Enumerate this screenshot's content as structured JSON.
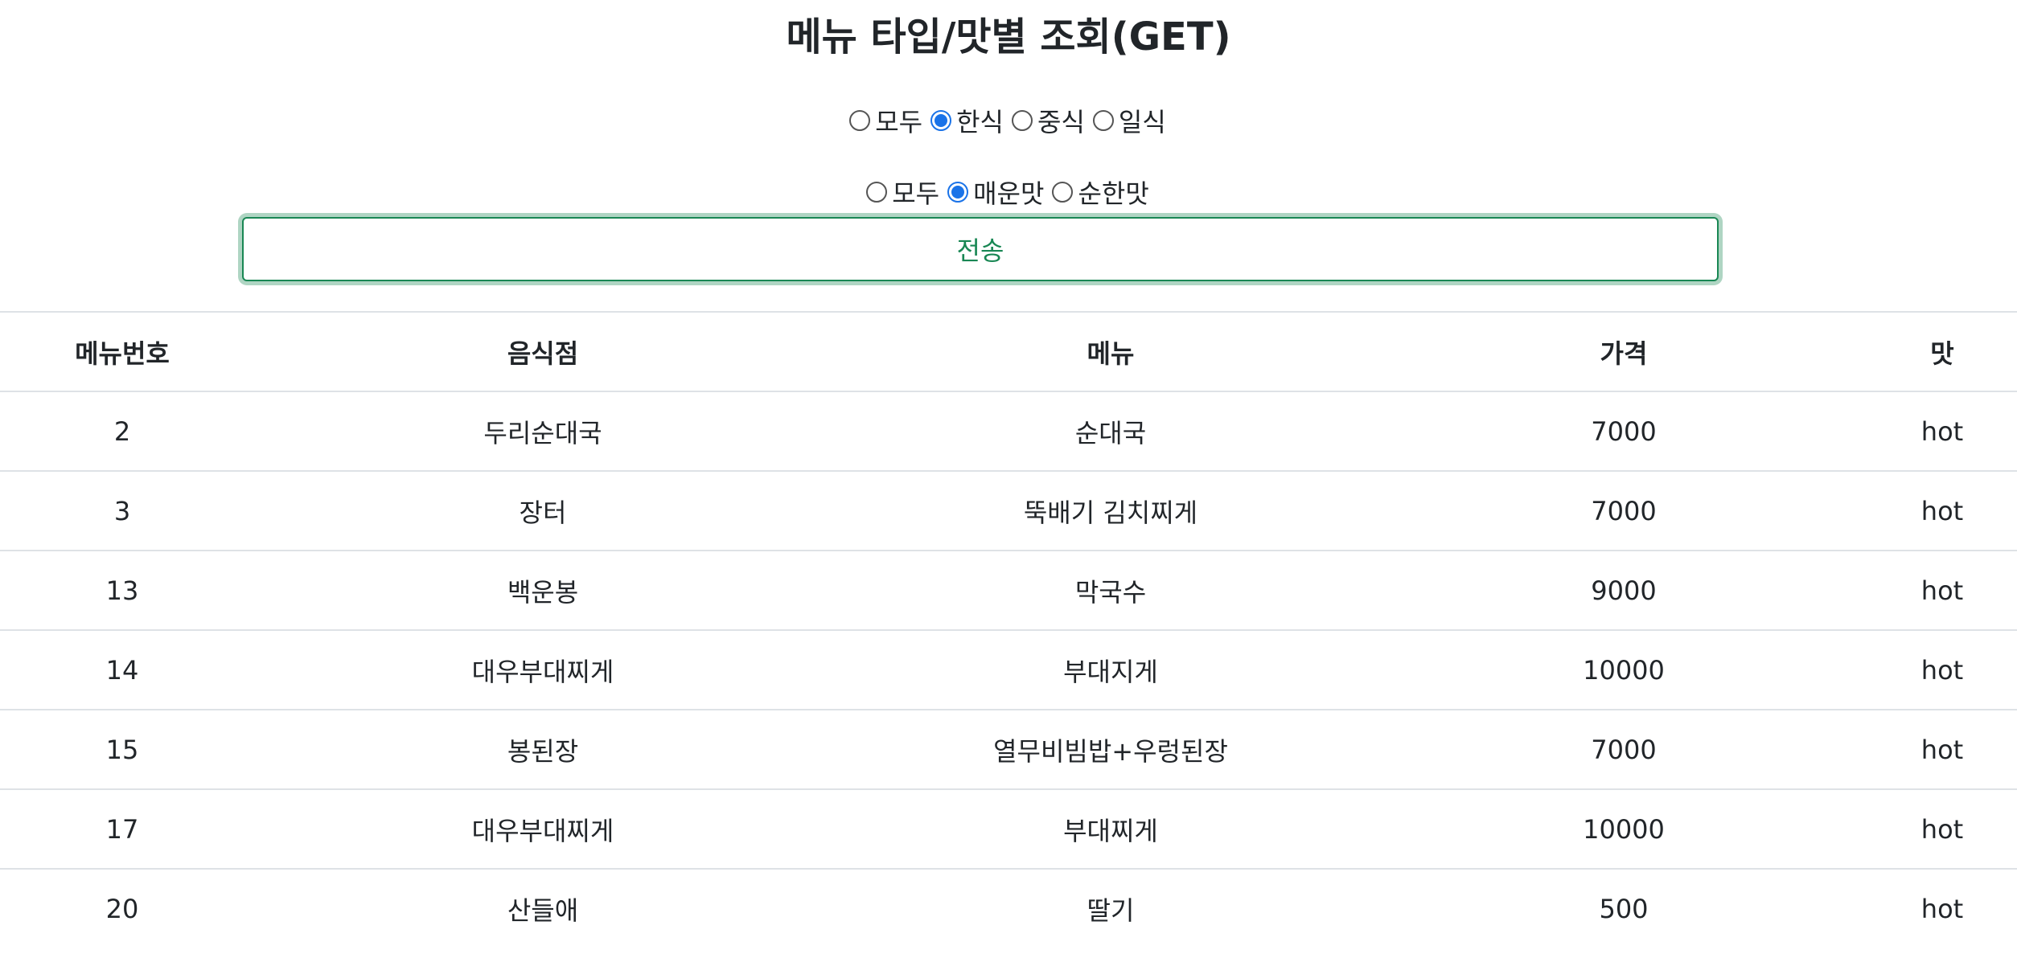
{
  "page": {
    "title": "메뉴 타입/맛별 조회(GET)"
  },
  "type_filter": {
    "options": [
      {
        "label": "모두",
        "checked": false
      },
      {
        "label": "한식",
        "checked": true
      },
      {
        "label": "중식",
        "checked": false
      },
      {
        "label": "일식",
        "checked": false
      }
    ]
  },
  "taste_filter": {
    "options": [
      {
        "label": "모두",
        "checked": false
      },
      {
        "label": "매운맛",
        "checked": true
      },
      {
        "label": "순한맛",
        "checked": false
      }
    ]
  },
  "submit": {
    "label": "전송"
  },
  "table": {
    "headers": [
      "메뉴번호",
      "음식점",
      "메뉴",
      "가격",
      "맛"
    ],
    "rows": [
      [
        "2",
        "두리순대국",
        "순대국",
        "7000",
        "hot"
      ],
      [
        "3",
        "장터",
        "뚝배기 김치찌게",
        "7000",
        "hot"
      ],
      [
        "13",
        "백운봉",
        "막국수",
        "9000",
        "hot"
      ],
      [
        "14",
        "대우부대찌게",
        "부대지게",
        "10000",
        "hot"
      ],
      [
        "15",
        "봉된장",
        "열무비빔밥+우렁된장",
        "7000",
        "hot"
      ],
      [
        "17",
        "대우부대찌게",
        "부대찌게",
        "10000",
        "hot"
      ],
      [
        "20",
        "산들애",
        "딸기",
        "500",
        "hot"
      ]
    ]
  },
  "colors": {
    "accent": "#1a73e8",
    "success": "#198754",
    "border": "#dee2e6"
  }
}
